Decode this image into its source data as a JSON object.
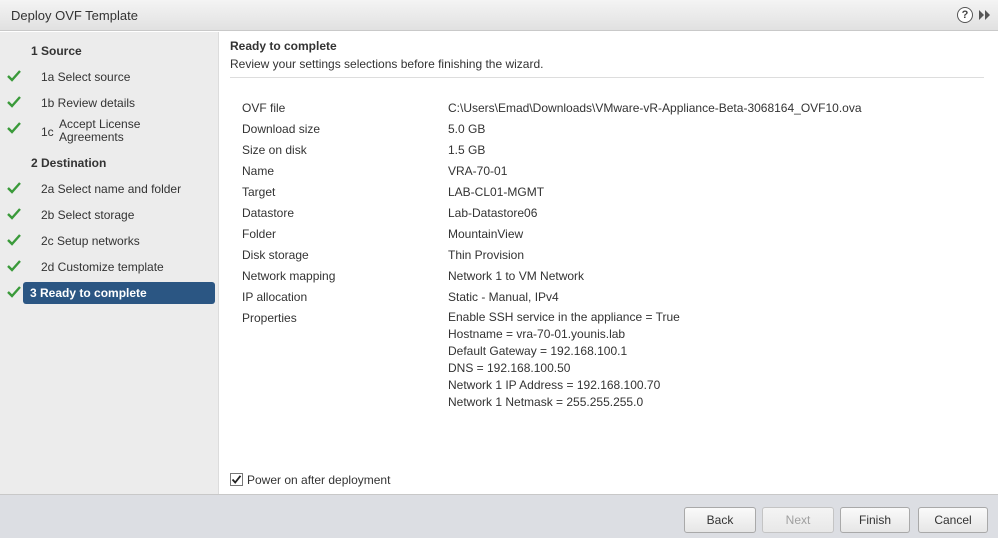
{
  "window": {
    "title": "Deploy OVF Template",
    "help_label": "?"
  },
  "sidebar": {
    "steps": [
      {
        "label": "1  Source",
        "kind": "section",
        "done": false
      },
      {
        "label": "1a  Select source",
        "kind": "sub",
        "done": true
      },
      {
        "label": "1b  Review details",
        "kind": "sub",
        "done": true
      },
      {
        "num": "1c",
        "label": "Accept License Agreements",
        "kind": "twoline",
        "done": true
      },
      {
        "label": "2  Destination",
        "kind": "section",
        "done": false
      },
      {
        "label": "2a  Select name and folder",
        "kind": "sub",
        "done": true
      },
      {
        "label": "2b  Select storage",
        "kind": "sub",
        "done": true
      },
      {
        "label": "2c  Setup networks",
        "kind": "sub",
        "done": true
      },
      {
        "label": "2d  Customize template",
        "kind": "sub",
        "done": true
      },
      {
        "label": "3  Ready to complete",
        "kind": "active",
        "done": true
      }
    ]
  },
  "main": {
    "title": "Ready to complete",
    "subtitle": "Review your settings selections before finishing the wizard.",
    "summary": [
      {
        "key": "OVF file",
        "value": "C:\\Users\\Emad\\Downloads\\VMware-vR-Appliance-Beta-3068164_OVF10.ova"
      },
      {
        "key": "Download size",
        "value": "5.0 GB"
      },
      {
        "key": "Size on disk",
        "value": "1.5 GB"
      },
      {
        "key": "Name",
        "value": "VRA-70-01"
      },
      {
        "key": "Target",
        "value": "LAB-CL01-MGMT"
      },
      {
        "key": "Datastore",
        "value": "Lab-Datastore06"
      },
      {
        "key": "Folder",
        "value": "MountainView"
      },
      {
        "key": "Disk storage",
        "value": "Thin Provision"
      },
      {
        "key": "Network mapping",
        "value": "Network 1 to VM Network"
      },
      {
        "key": "IP allocation",
        "value": "Static - Manual, IPv4"
      }
    ],
    "properties_key": "Properties",
    "properties": [
      "Enable SSH service in the appliance = True",
      "Hostname = vra-70-01.younis.lab",
      "Default Gateway = 192.168.100.1",
      "DNS = 192.168.100.50",
      "Network 1 IP Address = 192.168.100.70",
      "Network 1 Netmask = 255.255.255.0"
    ],
    "power_on_label": "Power on after deployment",
    "power_on_checked": true
  },
  "footer": {
    "back_label": "Back",
    "next_label": "Next",
    "finish_label": "Finish",
    "cancel_label": "Cancel"
  },
  "colors": {
    "check_green": "#3a9a3a",
    "active_step_bg": "#2b5683",
    "sidebar_bg": "#ececec",
    "footer_bg": "#dcdee3"
  },
  "icons": {
    "help": "help-icon",
    "expand": "double-chevron-right-icon",
    "check": "checkmark-icon"
  }
}
